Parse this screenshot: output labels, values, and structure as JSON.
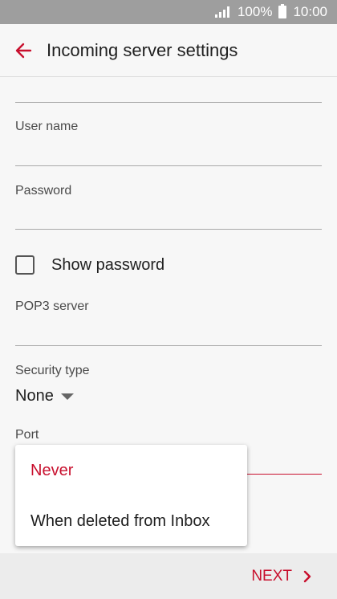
{
  "status_bar": {
    "battery": "100%",
    "time": "10:00",
    "icons": [
      "signal-icon",
      "battery-icon"
    ]
  },
  "header": {
    "title": "Incoming server settings",
    "back_icon": "arrow-left-icon"
  },
  "form": {
    "username_label": "User name",
    "username_value": "",
    "password_label": "Password",
    "password_value": "",
    "show_password_label": "Show password",
    "show_password_checked": false,
    "pop3_label": "POP3 server",
    "pop3_value": "",
    "security_label": "Security type",
    "security_value": "None",
    "port_label": "Port"
  },
  "dropdown": {
    "options": [
      {
        "label": "Never",
        "selected": true
      },
      {
        "label": "When deleted from Inbox",
        "selected": false
      }
    ]
  },
  "footer": {
    "next_label": "NEXT",
    "next_icon": "chevron-right-icon"
  },
  "colors": {
    "accent": "#c8102e",
    "status_bar": "#9e9e9e",
    "background": "#f7f7f7"
  }
}
